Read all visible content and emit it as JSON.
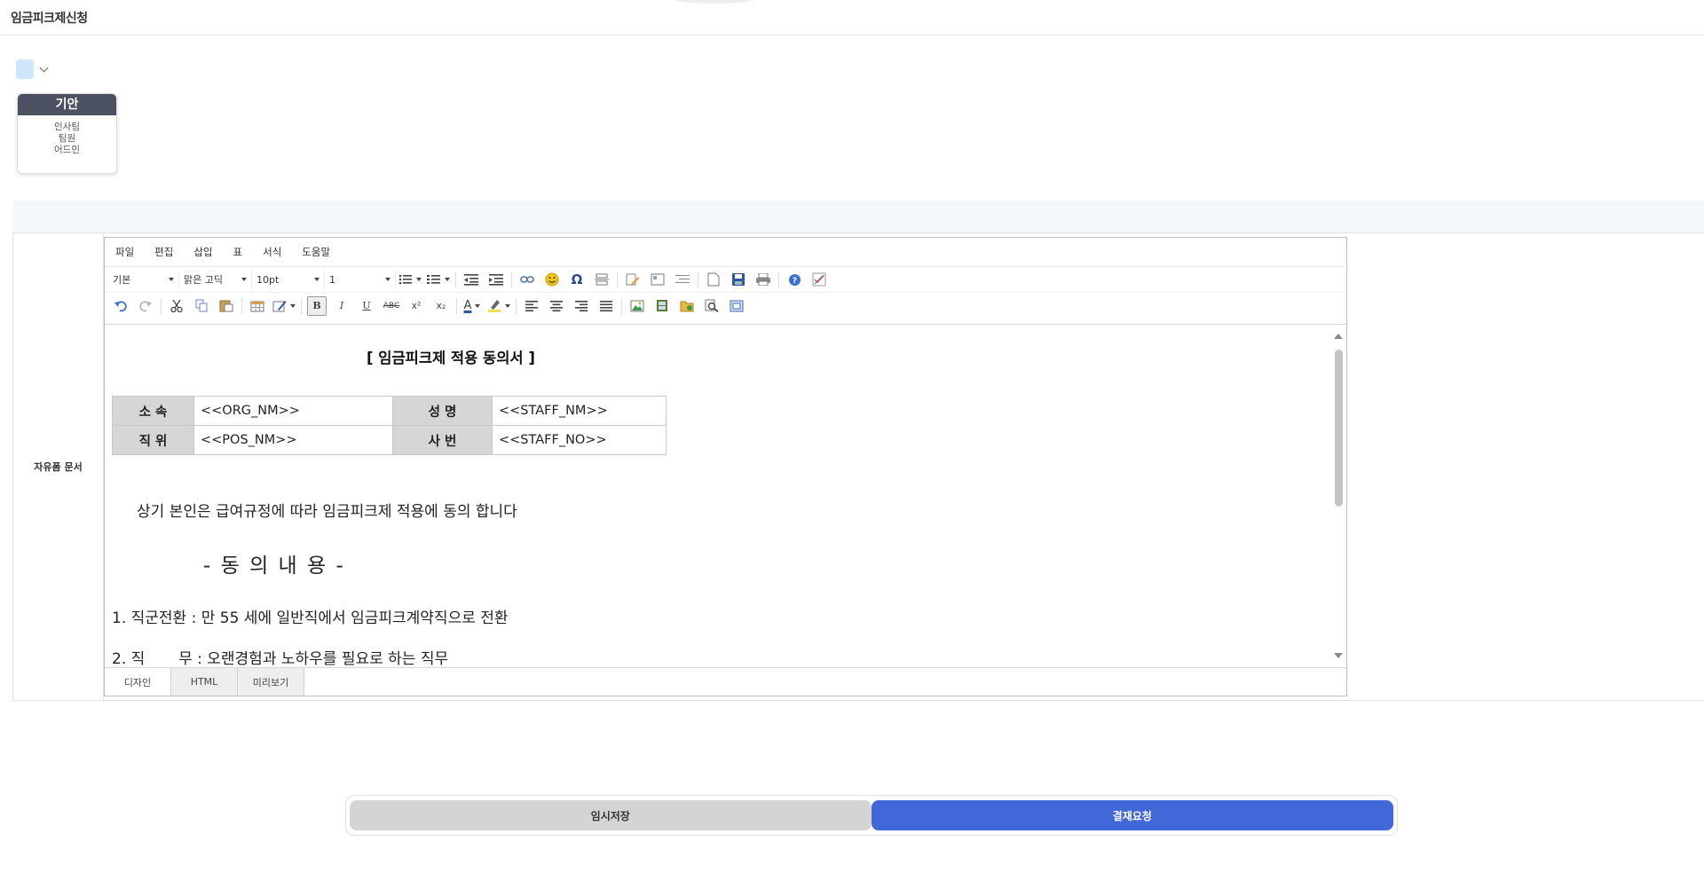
{
  "page": {
    "title": "임금피크제신청"
  },
  "approval": {
    "card_title": "기안",
    "dept": "인사팀",
    "position": "팀원",
    "name": "어드민"
  },
  "form": {
    "label": "자유폼 문서"
  },
  "editor": {
    "menu": [
      "파일",
      "편집",
      "삽입",
      "표",
      "서식",
      "도움말"
    ],
    "style_select": "기본",
    "font_select": "맑은 고딕",
    "size_select": "10pt",
    "line_select": "1",
    "toolbar": {
      "omega": "Ω",
      "bold": "B",
      "italic": "I",
      "underline": "U",
      "strike": "ABC",
      "superscript": "x²",
      "subscript": "x₂",
      "font_color": "A"
    },
    "tabs": [
      "디자인",
      "HTML",
      "미리보기"
    ]
  },
  "document": {
    "title": "[ 임금피크제 적용 동의서 ]",
    "table": {
      "row1": {
        "label1": "소 속",
        "value1": "<<ORG_NM>>",
        "label2": "성 명",
        "value2": "<<STAFF_NM>>"
      },
      "row2": {
        "label1": "직 위",
        "value1": "<<POS_NM>>",
        "label2": "사 번",
        "value2": "<<STAFF_NO>>"
      }
    },
    "paragraph": "상기 본인은 급여규정에 따라 임금피크제 적용에 동의 합니다",
    "heading": "- 동 의 내 용 -",
    "item1": "1. 직군전환 : 만 55 세에 일반직에서 임금피크계약직으로 전환",
    "item2": "2. 직       무 : 오랜경험과 노하우를 필요로 하는 직무"
  },
  "actions": {
    "temp_save": "임시저장",
    "submit": "결재요청"
  }
}
